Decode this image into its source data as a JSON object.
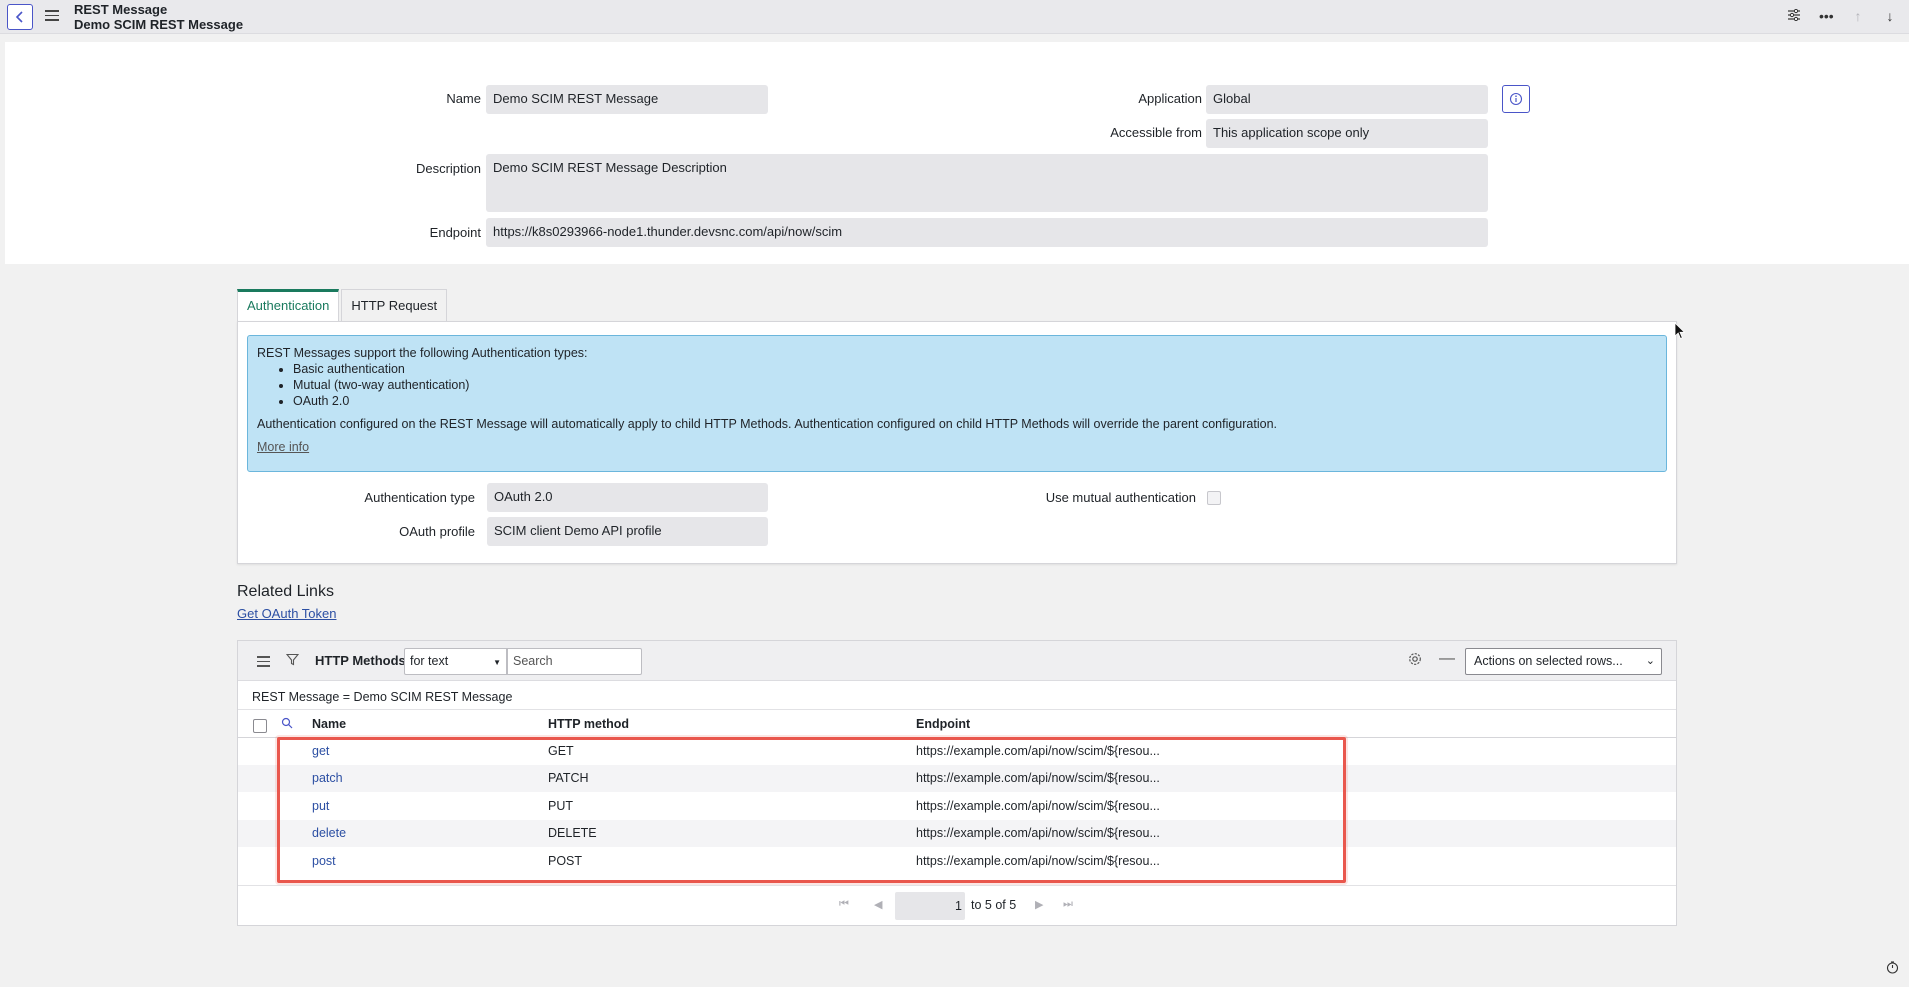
{
  "header": {
    "title": "REST Message",
    "subtitle": "Demo SCIM REST Message"
  },
  "form": {
    "name_label": "Name",
    "name_value": "Demo SCIM REST Message",
    "application_label": "Application",
    "application_value": "Global",
    "accessible_label": "Accessible from",
    "accessible_value": "This application scope only",
    "description_label": "Description",
    "description_value": "Demo SCIM REST Message Description",
    "endpoint_label": "Endpoint",
    "endpoint_value": "https://k8s0293966-node1.thunder.devsnc.com/api/now/scim"
  },
  "tabs": [
    {
      "label": "Authentication",
      "active": true
    },
    {
      "label": "HTTP Request",
      "active": false
    }
  ],
  "auth": {
    "info_intro": "REST Messages support the following Authentication types:",
    "info_items": [
      "Basic authentication",
      "Mutual (two-way authentication)",
      "OAuth 2.0"
    ],
    "info_para": "Authentication configured on the REST Message will automatically apply to child HTTP Methods. Authentication configured on child HTTP Methods will override the parent configuration.",
    "more_info": "More info",
    "type_label": "Authentication type",
    "type_value": "OAuth 2.0",
    "profile_label": "OAuth profile",
    "profile_value": "SCIM client Demo API profile",
    "mutual_label": "Use mutual authentication",
    "mutual_checked": false
  },
  "related": {
    "title": "Related Links",
    "link": "Get OAuth Token"
  },
  "list": {
    "title": "HTTP Methods",
    "filter_select": "for text",
    "search_placeholder": "Search",
    "actions": "Actions on selected rows...",
    "breadcrumb": "REST Message = Demo SCIM REST Message",
    "columns": [
      "Name",
      "HTTP method",
      "Endpoint"
    ],
    "rows": [
      {
        "name": "get",
        "method": "GET",
        "endpoint": "https://example.com/api/now/scim/${resou..."
      },
      {
        "name": "patch",
        "method": "PATCH",
        "endpoint": "https://example.com/api/now/scim/${resou..."
      },
      {
        "name": "put",
        "method": "PUT",
        "endpoint": "https://example.com/api/now/scim/${resou..."
      },
      {
        "name": "delete",
        "method": "DELETE",
        "endpoint": "https://example.com/api/now/scim/${resou..."
      },
      {
        "name": "post",
        "method": "POST",
        "endpoint": "https://example.com/api/now/scim/${resou..."
      }
    ],
    "pager": {
      "current": "1",
      "range_text": "to 5 of 5"
    }
  },
  "colors": {
    "accent": "#4a55c8",
    "active_tab": "#1a7a5e",
    "info_bg": "#bfe3f5",
    "highlight": "#e9574d",
    "link": "#2c4fa3"
  },
  "icons": [
    "back-arrow-icon",
    "hamburger-icon",
    "settings-sliders-icon",
    "more-icon",
    "arrow-up-icon",
    "arrow-down-icon",
    "info-icon",
    "filter-icon",
    "search-icon",
    "gear-icon",
    "minus-icon",
    "first-page-icon",
    "prev-page-icon",
    "next-page-icon",
    "last-page-icon",
    "timer-icon"
  ]
}
